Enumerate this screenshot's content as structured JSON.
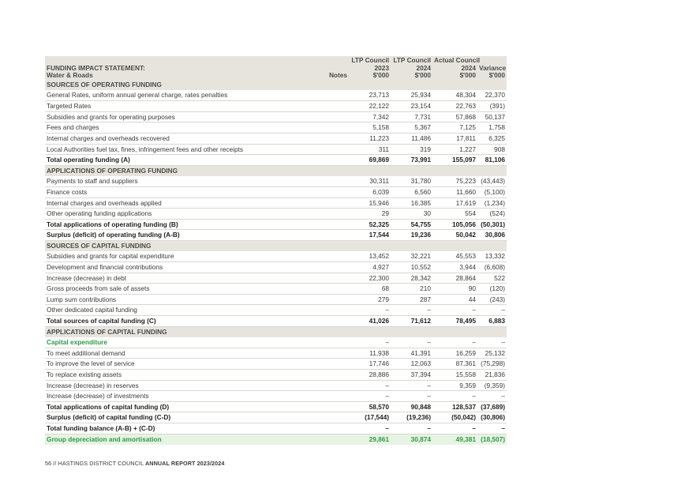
{
  "table": {
    "header": {
      "title_line1": "FUNDING IMPACT STATEMENT:",
      "title_line2": "Water & Roads",
      "notes": "Notes",
      "col1": [
        "LTP Council",
        "2023",
        "$'000"
      ],
      "col2": [
        "LTP Council",
        "2024",
        "$'000"
      ],
      "col3": [
        "Actual Council",
        "2024",
        "$'000"
      ],
      "col4": [
        "Variance",
        "$'000"
      ]
    },
    "rows": [
      {
        "type": "section",
        "label": "SOURCES OF OPERATING FUNDING"
      },
      {
        "type": "row",
        "label": "General Rates, uniform annual general charge, rates penalties",
        "v": [
          "23,713",
          "25,934",
          "48,304",
          "22,370"
        ]
      },
      {
        "type": "row",
        "label": "Targeted Rates",
        "v": [
          "22,122",
          "23,154",
          "22,763",
          "(391)"
        ]
      },
      {
        "type": "row",
        "label": "Subsidies and grants for operating purposes",
        "v": [
          "7,342",
          "7,731",
          "57,868",
          "50,137"
        ]
      },
      {
        "type": "row",
        "label": "Fees and charges",
        "v": [
          "5,158",
          "5,367",
          "7,125",
          "1,758"
        ]
      },
      {
        "type": "row",
        "label": "Internal charges and overheads recovered",
        "v": [
          "11,223",
          "11,486",
          "17,811",
          "6,325"
        ]
      },
      {
        "type": "row",
        "label": "Local Authorities fuel tax, fines, infringement fees and other receipts",
        "v": [
          "311",
          "319",
          "1,227",
          "908"
        ]
      },
      {
        "type": "total",
        "label": "Total operating funding (A)",
        "v": [
          "69,869",
          "73,991",
          "155,097",
          "81,106"
        ]
      },
      {
        "type": "section",
        "label": "APPLICATIONS OF OPERATING FUNDING"
      },
      {
        "type": "row",
        "label": "Payments to staff and suppliers",
        "v": [
          "30,311",
          "31,780",
          "75,223",
          "(43,443)"
        ]
      },
      {
        "type": "row",
        "label": "Finance costs",
        "v": [
          "6,039",
          "6,560",
          "11,660",
          "(5,100)"
        ]
      },
      {
        "type": "row",
        "label": "Internal charges and overheads applied",
        "v": [
          "15,946",
          "16,385",
          "17,619",
          "(1,234)"
        ]
      },
      {
        "type": "row",
        "label": "Other operating funding applications",
        "v": [
          "29",
          "30",
          "554",
          "(524)"
        ]
      },
      {
        "type": "total",
        "label": "Total applications of operating funding (B)",
        "v": [
          "52,325",
          "54,755",
          "105,056",
          "(50,301)"
        ]
      },
      {
        "type": "total",
        "label": "Surplus (deficit) of operating funding (A-B)",
        "v": [
          "17,544",
          "19,236",
          "50,042",
          "30,806"
        ]
      },
      {
        "type": "section",
        "label": "SOURCES OF CAPITAL FUNDING"
      },
      {
        "type": "row",
        "label": "Subsidies and grants for capital expenditure",
        "v": [
          "13,452",
          "32,221",
          "45,553",
          "13,332"
        ]
      },
      {
        "type": "row",
        "label": "Development and financial contributions",
        "v": [
          "4,927",
          "10,552",
          "3,944",
          "(6,608)"
        ]
      },
      {
        "type": "row",
        "label": "Increase (decrease) in debt",
        "v": [
          "22,300",
          "28,342",
          "28,864",
          "522"
        ]
      },
      {
        "type": "row",
        "label": "Gross proceeds from sale of assets",
        "v": [
          "68",
          "210",
          "90",
          "(120)"
        ]
      },
      {
        "type": "row",
        "label": "Lump sum contributions",
        "v": [
          "279",
          "287",
          "44",
          "(243)"
        ]
      },
      {
        "type": "row",
        "label": "Other dedicated capital funding",
        "v": [
          "–",
          "–",
          "–",
          "–"
        ]
      },
      {
        "type": "total",
        "label": "Total sources of capital funding (C)",
        "v": [
          "41,026",
          "71,612",
          "78,495",
          "6,883"
        ]
      },
      {
        "type": "section",
        "label": "APPLICATIONS OF CAPITAL FUNDING"
      },
      {
        "type": "green",
        "label": "Capital expenditure",
        "v": [
          "–",
          "–",
          "–",
          "–"
        ]
      },
      {
        "type": "row",
        "label": "To meet additional demand",
        "v": [
          "11,938",
          "41,391",
          "16,259",
          "25,132"
        ]
      },
      {
        "type": "row",
        "label": "To improve the level of service",
        "v": [
          "17,746",
          "12,063",
          "87,361",
          "(75,298)"
        ]
      },
      {
        "type": "row",
        "label": "To replace existing assets",
        "v": [
          "28,886",
          "37,394",
          "15,558",
          "21,836"
        ]
      },
      {
        "type": "row",
        "label": "Increase (decrease) in reserves",
        "v": [
          "–",
          "–",
          "9,359",
          "(9,359)"
        ]
      },
      {
        "type": "row",
        "label": "Increase (decrease) of investments",
        "v": [
          "–",
          "–",
          "–",
          "–"
        ]
      },
      {
        "type": "total",
        "label": "Total applications of capital funding (D)",
        "v": [
          "58,570",
          "90,848",
          "128,537",
          "(37,689)"
        ]
      },
      {
        "type": "total",
        "label": "Surplus (deficit) of capital funding (C-D)",
        "v": [
          "(17,544)",
          "(19,236)",
          "(50,042)",
          "(30,806)"
        ]
      },
      {
        "type": "total",
        "label": "Total funding balance (A-B) + (C-D)",
        "v": [
          "–",
          "–",
          "–",
          "–"
        ]
      },
      {
        "type": "greenrow",
        "label": "Group depreciation and amortisation",
        "v": [
          "29,861",
          "30,874",
          "49,381",
          "(18,507)"
        ]
      }
    ]
  },
  "footer": {
    "prefix": "56 // HASTINGS DISTRICT COUNCIL ",
    "bold": "ANNUAL REPORT 2023/2024"
  }
}
